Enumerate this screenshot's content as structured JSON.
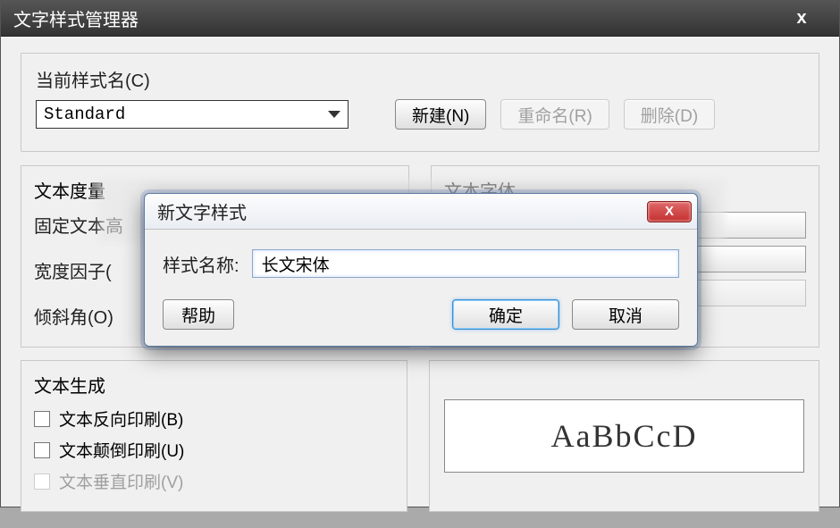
{
  "main": {
    "title": "文字样式管理器",
    "current_style_label": "当前样式名(C)",
    "current_style_value": "Standard",
    "new_button": "新建(N)",
    "rename_button": "重命名(R)",
    "delete_button": "删除(D)",
    "text_measure_heading": "文本度量",
    "fixed_height_label": "固定文本高",
    "width_factor_label": "宽度因子(",
    "oblique_angle_label": "倾斜角(O)",
    "text_font_heading": "文本字体",
    "text_gen_heading": "文本生成",
    "checkbox1": "文本反向印刷(B)",
    "checkbox2": "文本颠倒印刷(U)",
    "checkbox3": "文本垂直印刷(V)",
    "preview_text": "AaBbCcD"
  },
  "dialog": {
    "title": "新文字样式",
    "name_label": "样式名称:",
    "name_value": "长文宋体",
    "help_button": "帮助",
    "ok_button": "确定",
    "cancel_button": "取消"
  }
}
